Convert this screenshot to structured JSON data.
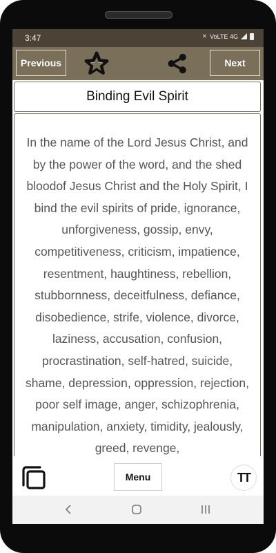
{
  "status": {
    "time": "3:47",
    "network": "VoLTE 4G"
  },
  "toolbar": {
    "previous_label": "Previous",
    "next_label": "Next"
  },
  "page": {
    "title": "Binding Evil Spirit",
    "body": "In the name of the Lord Jesus Christ, and by the power of the word, and the shed bloodof Jesus Christ and the Holy Spirit, I bind the evil spirits of pride, ignorance, unforgiveness, gossip, envy, competitiveness, criticism, impatience, resentment, haughtiness, rebellion, stubbornness, deceitfulness, defiance, disobedience, strife, violence, divorce, laziness, accusation, confusion, procrastination, self-hatred, suicide, shame, depression, oppression, rejection, poor self image, anger, schizophrenia, manipulation, anxiety, timidity, jealously, greed, revenge,"
  },
  "bottom": {
    "menu_label": "Menu",
    "font_button_label": "TT"
  },
  "icons": {
    "favorite": "star-icon",
    "share": "share-icon",
    "copy": "copy-icon",
    "font": "font-size-icon",
    "back": "back-icon",
    "home": "home-icon",
    "recent": "recent-apps-icon"
  },
  "colors": {
    "statusbar": "#4b4336",
    "toolbar": "#7a6f59",
    "text": "#555555"
  }
}
